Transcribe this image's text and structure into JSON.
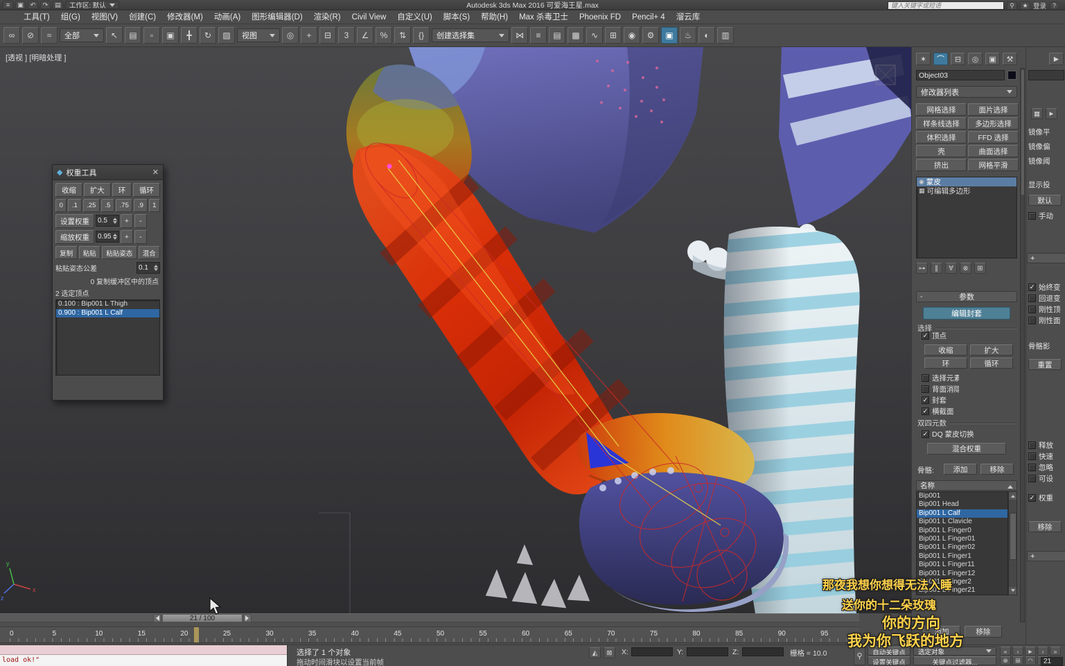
{
  "theme": {
    "selection_blue": "#2f67a3",
    "active_teal": "#4e8096",
    "panel_grey": "#4d4d4d",
    "subtitle_yellow": "#ffd24a"
  },
  "titlebar": {
    "title": "Autodesk 3ds Max 2016    可爱海王星.max",
    "quick_icons": [
      {
        "name": "application-menu-icon",
        "glyph": "≡"
      },
      {
        "name": "save-icon",
        "glyph": "▣"
      },
      {
        "name": "undo-icon",
        "glyph": "↶"
      },
      {
        "name": "redo-icon",
        "glyph": "↷"
      },
      {
        "name": "project-folder-icon",
        "glyph": "▤"
      }
    ],
    "workspace_label": "工作区: 默认",
    "search_placeholder": "键入关键字或短语",
    "right_icons": [
      {
        "name": "search-icon",
        "glyph": "⚲"
      },
      {
        "name": "favorites-icon",
        "glyph": "★"
      },
      {
        "name": "help-icon",
        "glyph": "?"
      }
    ],
    "signin_label": "登录"
  },
  "menubar": {
    "items": [
      "工具(T)",
      "组(G)",
      "视图(V)",
      "创建(C)",
      "修改器(M)",
      "动画(A)",
      "图形编辑器(D)",
      "渲染(R)",
      "Civil View",
      "自定义(U)",
      "脚本(S)",
      "帮助(H)",
      "Max 杀毒卫士",
      "Phoenix FD",
      "Pencil+ 4",
      "溜云库"
    ]
  },
  "toolbar": {
    "icons_a": [
      {
        "name": "select-and-link-icon",
        "glyph": "∞"
      },
      {
        "name": "unlink-selection-icon",
        "glyph": "⊘"
      },
      {
        "name": "bind-to-space-warp-icon",
        "glyph": "≈"
      }
    ],
    "filter_dropdown": "全部",
    "icons_b": [
      {
        "name": "select-object-icon",
        "glyph": "↖"
      },
      {
        "name": "select-by-name-icon",
        "glyph": "▤"
      },
      {
        "name": "rectangular-selection-region-icon",
        "glyph": "▫"
      },
      {
        "name": "window-crossing-toggle-icon",
        "glyph": "▣"
      },
      {
        "name": "select-and-move-icon",
        "glyph": "╋"
      },
      {
        "name": "select-and-rotate-icon",
        "glyph": "↻"
      },
      {
        "name": "select-and-scale-icon",
        "glyph": "▨"
      }
    ],
    "coord_dropdown": "视图",
    "icons_c": [
      {
        "name": "use-pivot-point-icon",
        "glyph": "◎"
      },
      {
        "name": "select-and-manipulate-icon",
        "glyph": "+"
      },
      {
        "name": "keyboard-override-icon",
        "glyph": "⊟"
      },
      {
        "name": "snap-toggle-3d-icon",
        "glyph": "3"
      },
      {
        "name": "angle-snap-icon",
        "glyph": "∠"
      },
      {
        "name": "percent-snap-icon",
        "glyph": "%"
      },
      {
        "name": "spinner-snap-icon",
        "glyph": "⇅"
      },
      {
        "name": "edit-named-sets-icon",
        "glyph": "{}"
      }
    ],
    "sets_dropdown": "创建选择集",
    "icons_d": [
      {
        "name": "mirror-icon",
        "glyph": "⋈"
      },
      {
        "name": "align-icon",
        "glyph": "≡"
      },
      {
        "name": "layer-manager-icon",
        "glyph": "▤"
      },
      {
        "name": "graphite-ribbon-icon",
        "glyph": "▩"
      },
      {
        "name": "curve-editor-icon",
        "glyph": "∿"
      },
      {
        "name": "schematic-view-icon",
        "glyph": "⊞"
      },
      {
        "name": "material-editor-icon",
        "glyph": "◉"
      },
      {
        "name": "render-setup-icon",
        "glyph": "⚙"
      },
      {
        "name": "rendered-frame-icon",
        "glyph": "▣",
        "active": true
      },
      {
        "name": "render-production-icon",
        "glyph": "♨"
      },
      {
        "name": "render-iterative-icon",
        "glyph": "◐"
      },
      {
        "name": "snapshot-icon",
        "glyph": "▥"
      }
    ]
  },
  "viewport": {
    "label": "[透视 ]  [明暗处理 ]",
    "axis_x": "x",
    "axis_y": "y",
    "axis_z": "z"
  },
  "weight_tool": {
    "title": "权重工具",
    "title_icon_glyph": "◆",
    "close_glyph": "✕",
    "grow_buttons": [
      "收缩",
      "扩大",
      "环",
      "循环"
    ],
    "preset_buttons": [
      "0",
      ".1",
      ".25",
      ".5",
      ".75",
      ".9",
      "1"
    ],
    "set_weight_label": "设置权重",
    "set_weight_value": "0.5",
    "scale_weight_label": "缩放权重",
    "scale_weight_value": "0.95",
    "plus_label": "+",
    "minus_label": "-",
    "copy_row": [
      "复制",
      "粘贴",
      "粘贴姿态",
      "混合"
    ],
    "tolerance_label": "粘贴姿态公差",
    "tolerance_value": "0.1",
    "buffer_line": "0 复制缓冲区中的顶点",
    "selected_line": "2 选定顶点",
    "entries": [
      {
        "label": "0.100 : Bip001 L Thigh"
      },
      {
        "label": "0.900 : Bip001 L Calf",
        "selected": true
      }
    ]
  },
  "command_panel": {
    "tabs": [
      {
        "name": "create-tab-icon",
        "glyph": "✶"
      },
      {
        "name": "modify-tab-icon",
        "glyph": "⌒",
        "active": true
      },
      {
        "name": "hierarchy-tab-icon",
        "glyph": "⊟"
      },
      {
        "name": "motion-tab-icon",
        "glyph": "◎"
      },
      {
        "name": "display-tab-icon",
        "glyph": "▣"
      },
      {
        "name": "utilities-tab-icon",
        "glyph": "⚒"
      }
    ],
    "object_name": "Object03",
    "modifier_list_label": "修改器列表",
    "modifier_buttons": [
      "网格选择",
      "面片选择",
      "样条线选择",
      "多边形选择",
      "体积选择",
      "FFD 选择",
      "壳",
      "曲面选择",
      "挤出",
      "网格平滑"
    ],
    "stack": [
      {
        "label": "蒙皮",
        "glyph": "◉",
        "selected": true
      },
      {
        "label": "可编辑多边形",
        "glyph": "▦"
      }
    ],
    "stack_tools": [
      {
        "name": "pin-stack-icon",
        "glyph": "⊶"
      },
      {
        "name": "show-end-result-icon",
        "glyph": "∥"
      },
      {
        "name": "make-unique-icon",
        "glyph": "∀"
      },
      {
        "name": "remove-modifier-icon",
        "glyph": "⊗"
      },
      {
        "name": "configure-modifier-sets-icon",
        "glyph": "⊞"
      }
    ],
    "collapse_glyph": "-",
    "params_title": "参数",
    "edit_envelopes_label": "编辑封套",
    "select_group_label": "选择",
    "vertices_check": {
      "label": "顶点",
      "checked": true
    },
    "shrink_label": "收缩",
    "grow_label": "扩大",
    "ring_label": "环",
    "loop_label": "循环",
    "select_checks": [
      {
        "label": "选择元素",
        "checked": false
      },
      {
        "label": "背面消隐顶点",
        "checked": false
      },
      {
        "label": "封套",
        "checked": true
      },
      {
        "label": "横截面",
        "checked": true
      }
    ],
    "dq_group_label": "双四元数",
    "dq_check": {
      "label": "DQ 蒙皮切换",
      "checked": true
    },
    "blend_weights_label": "混合权重",
    "bones_label": "骨骼:",
    "add_label": "添加",
    "remove_label": "移除",
    "name_header": "名称",
    "bones": [
      {
        "label": "Bip001"
      },
      {
        "label": "Bip001 Head"
      },
      {
        "label": "Bip001 L Calf",
        "selected": true
      },
      {
        "label": "Bip001 L Clavicle"
      },
      {
        "label": "Bip001 L Finger0"
      },
      {
        "label": "Bip001 L Finger01"
      },
      {
        "label": "Bip001 L Finger02"
      },
      {
        "label": "Bip001 L Finger1"
      },
      {
        "label": "Bip001 L Finger11"
      },
      {
        "label": "Bip001 L Finger12"
      },
      {
        "label": "Bip001 L Finger2"
      },
      {
        "label": "Bip001 L Finger21"
      }
    ],
    "cross_add_label": "添加",
    "cross_remove_label": "移除"
  },
  "right_strip": {
    "top_icons": [
      {
        "name": "weight-table-icon",
        "glyph": "▦"
      },
      {
        "name": "paint-options-icon",
        "glyph": "►"
      }
    ],
    "mirror_labels": [
      "镜像平",
      "镜像偏",
      "镜像阈"
    ],
    "display_label": "显示投",
    "default_label": "默认",
    "manual_check": {
      "label": "手动",
      "checked": false
    },
    "expand_glyph": "+",
    "advanced_checks": [
      {
        "label": "始终变",
        "checked": true
      },
      {
        "label": "回退变",
        "checked": false
      },
      {
        "label": "刚性顶",
        "checked": false
      },
      {
        "label": "刚性面",
        "checked": false
      }
    ],
    "bone_limit_label": "骨骼影",
    "reset_label": "重置",
    "lower_checks": [
      {
        "label": "释放",
        "checked": false
      },
      {
        "label": "快速",
        "checked": false
      },
      {
        "label": "忽略",
        "checked": false
      },
      {
        "label": "可设",
        "checked": false
      }
    ],
    "weight_check": {
      "label": "权重",
      "checked": true
    },
    "remove_label": "移除"
  },
  "subtitles": [
    "那夜我想你想得无法入睡",
    "送你的十二朵玫瑰",
    "你的方向",
    "我为你飞跃的地方"
  ],
  "timeline": {
    "slider_label": "21 / 100",
    "ticks": [
      "0",
      "5",
      "10",
      "15",
      "20",
      "25",
      "30",
      "35",
      "40",
      "45",
      "50",
      "55",
      "60",
      "65",
      "70",
      "75",
      "80",
      "85",
      "90",
      "95"
    ]
  },
  "statusbar": {
    "macro_line": "",
    "listener_line": "load ok!\"",
    "status_line": "选择了 1 个对象",
    "prompt_line": "拖动时间滑块以设置当前帧",
    "isolate_icon_glyph": "◭",
    "lock_icon_glyph": "⊠",
    "x_label": "X:",
    "y_label": "Y:",
    "z_label": "Z:",
    "grid_label": "栅格 = 10.0",
    "key_button_glyph": "⚲",
    "autokey_label": "自动关键点",
    "selected_filter_label": "选定对象",
    "setkey_label": "设置关键点",
    "keyfilter_label": "关键点过滤器...",
    "playback": [
      {
        "name": "go-to-start-button",
        "glyph": "«"
      },
      {
        "name": "previous-frame-button",
        "glyph": "‹"
      },
      {
        "name": "play-button",
        "glyph": "►"
      },
      {
        "name": "next-frame-button",
        "glyph": "›"
      },
      {
        "name": "go-to-end-button",
        "glyph": "»"
      }
    ],
    "nav_icons": [
      {
        "name": "zoom-icon",
        "glyph": "⊕"
      },
      {
        "name": "pan-icon",
        "glyph": "⊞"
      },
      {
        "name": "orbit-icon",
        "glyph": "◠"
      },
      {
        "name": "maximize-viewport-icon",
        "glyph": "⊡"
      }
    ],
    "frame_value": "21"
  }
}
